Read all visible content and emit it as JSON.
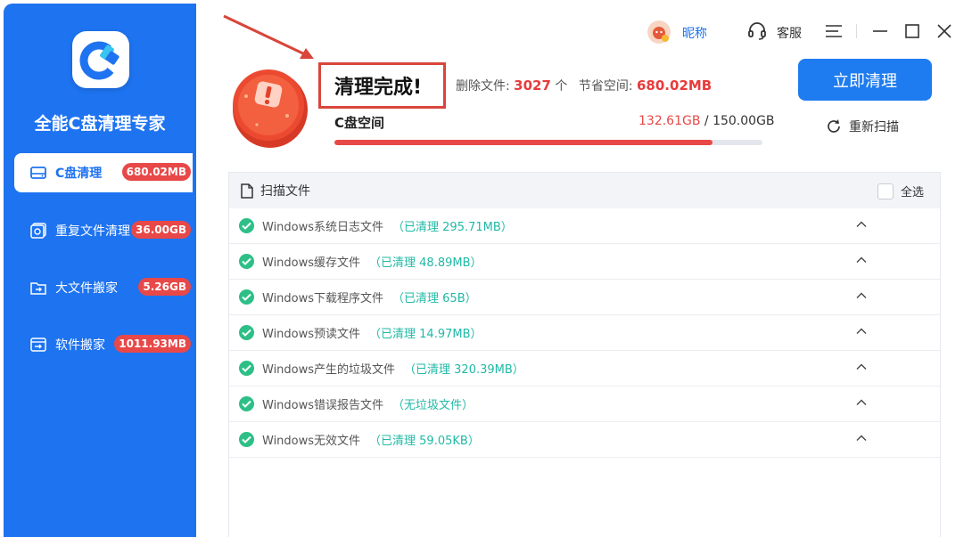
{
  "sidebar": {
    "app_name": "全能C盘清理专家",
    "items": [
      {
        "label": "C盘清理",
        "badge": "680.02MB",
        "icon": "drive-icon",
        "active": true
      },
      {
        "label": "重复文件清理",
        "badge": "36.00GB",
        "icon": "duplicate-files-icon",
        "active": false
      },
      {
        "label": "大文件搬家",
        "badge": "5.26GB",
        "icon": "move-file-icon",
        "active": false
      },
      {
        "label": "软件搬家",
        "badge": "1011.93MB",
        "icon": "software-move-icon",
        "active": false
      }
    ]
  },
  "header": {
    "nickname": "昵称",
    "support_label": "客服",
    "window_controls": [
      "menu-icon",
      "minimize-icon",
      "maximize-icon",
      "close-icon"
    ]
  },
  "summary": {
    "title": "清理完成!",
    "deleted_label": "删除文件:",
    "deleted_count": "3027",
    "deleted_unit": "个",
    "saved_label": "节省空间:",
    "saved_value": "680.02MB",
    "disk_label": "C盘空间",
    "disk_used": "132.61GB",
    "disk_separator": " / ",
    "disk_total": "150.00GB",
    "disk_used_fraction": 0.884,
    "clean_button": "立即清理",
    "rescan_label": "重新扫描"
  },
  "panel": {
    "title": "扫描文件",
    "select_all": "全选",
    "rows": [
      {
        "name": "Windows系统日志文件",
        "status": "（已清理 295.71MB）"
      },
      {
        "name": "Windows缓存文件",
        "status": "（已清理 48.89MB）"
      },
      {
        "name": "Windows下载程序文件",
        "status": "（已清理 65B）"
      },
      {
        "name": "Windows预读文件",
        "status": "（已清理 14.97MB）"
      },
      {
        "name": "Windows产生的垃圾文件",
        "status": "（已清理 320.39MB）"
      },
      {
        "name": "Windows错误报告文件",
        "status": "（无垃圾文件）"
      },
      {
        "name": "Windows无效文件",
        "status": "（已清理 59.05KB）"
      }
    ]
  },
  "colors": {
    "brand_blue": "#1e73f0",
    "badge_red": "#e84848",
    "success_green": "#2ebf87",
    "status_teal": "#20b9a6"
  }
}
